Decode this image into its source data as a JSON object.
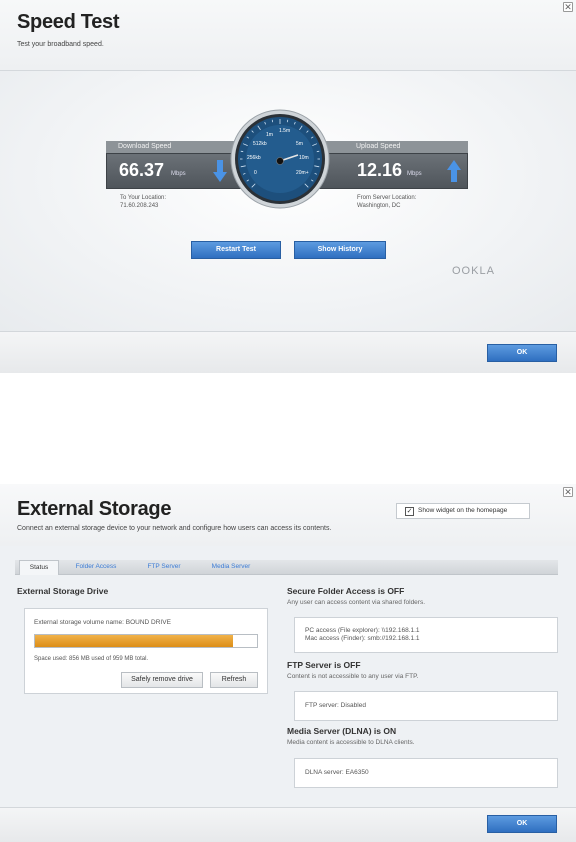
{
  "speed_test": {
    "title": "Speed Test",
    "subtitle": "Test your broadband speed.",
    "download": {
      "label": "Download Speed",
      "value": "66.37",
      "unit": "Mbps",
      "location_label": "To Your Location:",
      "location_value": "71.60.208.243"
    },
    "upload": {
      "label": "Upload Speed",
      "value": "12.16",
      "unit": "Mbps",
      "location_label": "From Server Location:",
      "location_value": "Washington, DC"
    },
    "gauge": {
      "labels": [
        "0",
        "256kb",
        "512kb",
        "1m",
        "1.5m",
        "5m",
        "10m",
        "20m+"
      ]
    },
    "restart_label": "Restart Test",
    "history_label": "Show History",
    "brand": "OOKLA",
    "ok_label": "OK",
    "accent": "#3a7bd5"
  },
  "external_storage": {
    "title": "External Storage",
    "subtitle": "Connect an external storage device to your network and configure how users can access its contents.",
    "widget_label": "Show widget on the homepage",
    "widget_checked": true,
    "tabs": [
      "Status",
      "Folder Access",
      "FTP Server",
      "Media Server"
    ],
    "drive": {
      "heading": "External Storage Drive",
      "volume_text": "External storage volume name: BOUND DRIVE",
      "space_text": "Space used: 856 MB used of 959 MB total.",
      "used_fraction": 0.89,
      "safely_remove_label": "Safely remove drive",
      "refresh_label": "Refresh"
    },
    "secure": {
      "heading": "Secure Folder Access is OFF",
      "sub": "Any user can access content via shared folders.",
      "pc_access": "PC access (File explorer): \\\\192.168.1.1",
      "mac_access": "Mac access (Finder): smb://192.168.1.1"
    },
    "ftp": {
      "heading": "FTP Server is OFF",
      "sub": "Content is not accessible to any user via FTP.",
      "server": "FTP server: Disabled"
    },
    "media": {
      "heading": "Media Server (DLNA) is ON",
      "sub": "Media content is accessible to DLNA clients.",
      "server": "DLNA server: EA6350"
    },
    "ok_label": "OK",
    "progress_color": "#e39a22"
  }
}
